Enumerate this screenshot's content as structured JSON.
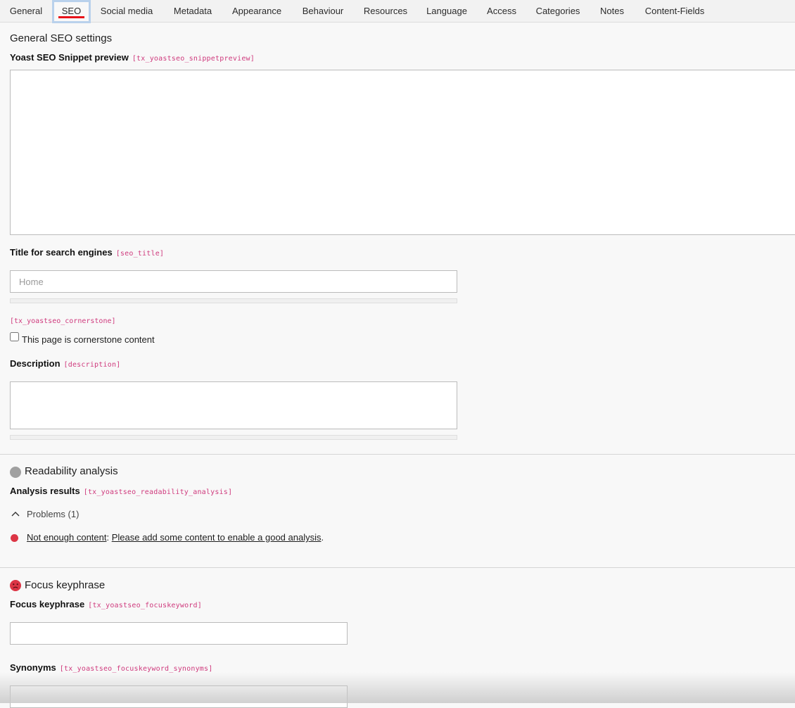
{
  "tabs": [
    {
      "label": "General"
    },
    {
      "label": "SEO",
      "active": true
    },
    {
      "label": "Social media"
    },
    {
      "label": "Metadata"
    },
    {
      "label": "Appearance"
    },
    {
      "label": "Behaviour"
    },
    {
      "label": "Resources"
    },
    {
      "label": "Language"
    },
    {
      "label": "Access"
    },
    {
      "label": "Categories"
    },
    {
      "label": "Notes"
    },
    {
      "label": "Content-Fields"
    }
  ],
  "general": {
    "title": "General SEO settings",
    "snippet": {
      "label": "Yoast SEO Snippet preview",
      "code": "[tx_yoastseo_snippetpreview]"
    },
    "seo_title": {
      "label": "Title for search engines",
      "code": "[seo_title]",
      "placeholder": "Home",
      "value": ""
    },
    "cornerstone": {
      "code": "[tx_yoastseo_cornerstone]",
      "label": "This page is cornerstone content",
      "checked": false
    },
    "description": {
      "label": "Description",
      "code": "[description]",
      "value": ""
    }
  },
  "readability": {
    "title": "Readability analysis",
    "results_label": "Analysis results",
    "results_code": "[tx_yoastseo_readability_analysis]",
    "problems_toggle": "Problems (1)",
    "problem": {
      "title": "Not enough content",
      "separator": ": ",
      "text": "Please add some content to enable a good analysis",
      "end": "."
    }
  },
  "focus": {
    "title": "Focus keyphrase",
    "keyphrase": {
      "label": "Focus keyphrase",
      "code": "[tx_yoastseo_focuskeyword]",
      "value": ""
    },
    "synonyms": {
      "label": "Synonyms",
      "code": "[tx_yoastseo_focuskeyword_synonyms]",
      "value": ""
    }
  },
  "colors": {
    "accent_red": "#e8131a",
    "field_code": "#cf3a7d",
    "status_grey": "#a0a0a0",
    "status_bad": "#dc3545",
    "tab_focus": "#b9d1ec"
  },
  "icons": {
    "readability_status": "grey-circle-icon",
    "problem_bullet": "red-dot-icon",
    "problems_chevron": "chevron-up-icon",
    "focus_status": "sad-face-icon"
  }
}
